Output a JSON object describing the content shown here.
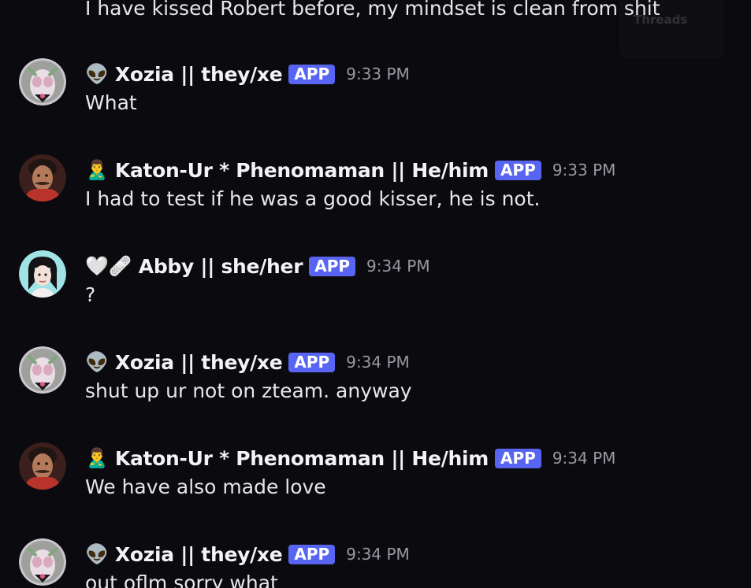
{
  "top_message": {
    "text": "I have kissed Robert before, my mindset is clean from shit"
  },
  "threads_popout": {
    "label": "Threads"
  },
  "messages": [
    {
      "emoji": "👽",
      "username": "Xozia || they/xe",
      "badge": "APP",
      "time": "9:33 PM",
      "text": "What",
      "avatar": "xozia"
    },
    {
      "emoji": "🙎‍♂",
      "username": "Katon-Ur * Phenomaman || He/him",
      "badge": "APP",
      "time": "9:33 PM",
      "text": "I had to test if he was a good kisser, he is not.",
      "avatar": "katon"
    },
    {
      "emoji": "🤍🩹",
      "username": "Abby || she/her",
      "badge": "APP",
      "time": "9:34 PM",
      "text": "?",
      "avatar": "abby"
    },
    {
      "emoji": "👽",
      "username": "Xozia || they/xe",
      "badge": "APP",
      "time": "9:34 PM",
      "text": "shut up ur not on zteam. anyway",
      "avatar": "xozia"
    },
    {
      "emoji": "🙎‍♂",
      "username": "Katon-Ur * Phenomaman || He/him",
      "badge": "APP",
      "time": "9:34 PM",
      "text": "We have also made love",
      "avatar": "katon"
    },
    {
      "emoji": "👽",
      "username": "Xozia || they/xe",
      "badge": "APP",
      "time": "9:34 PM",
      "text": "out oflm sorry what",
      "avatar": "xozia"
    }
  ],
  "colors": {
    "background": "#0b0a0e",
    "app_badge": "#5865f2",
    "timestamp": "#989aa2",
    "text": "#e6e7ea"
  }
}
